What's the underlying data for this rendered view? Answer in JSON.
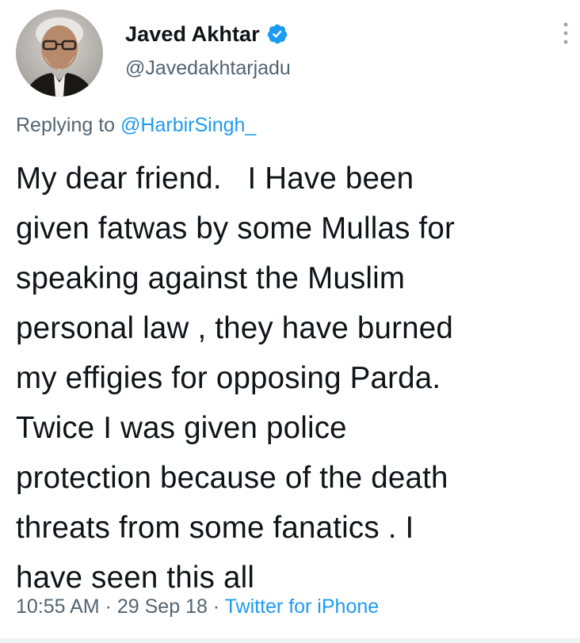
{
  "author": {
    "display_name": "Javed Akhtar",
    "handle": "@Javedakhtarjadu",
    "verified": true,
    "avatar_icon": "profile-photo"
  },
  "reply": {
    "prefix": "Replying to ",
    "mention": "@HarbirSingh_"
  },
  "tweet": {
    "lines": [
      "My dear friend.   I Have been",
      "given fatwas by some Mullas for",
      "speaking against the Muslim",
      "personal law , they have burned",
      "my effigies for opposing Parda.",
      "Twice I was given police",
      "protection because of the death",
      "threats from some fanatics . I",
      "have seen this all"
    ]
  },
  "meta": {
    "time": "10:55 AM",
    "sep1": " · ",
    "date": "29 Sep 18",
    "sep2": " · ",
    "source": "Twitter for iPhone"
  },
  "colors": {
    "text": "#0f1419",
    "secondary": "#536471",
    "accent": "#1d9bf0"
  }
}
